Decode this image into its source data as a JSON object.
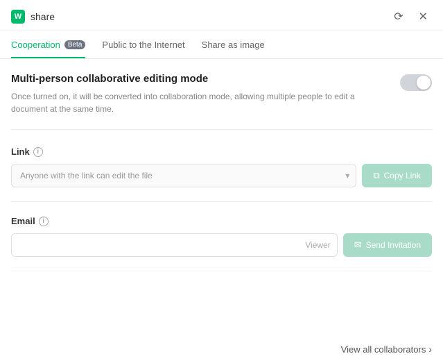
{
  "titleBar": {
    "appName": "share",
    "appIconText": "W",
    "refreshLabel": "⟳",
    "closeLabel": "✕"
  },
  "tabs": [
    {
      "id": "cooperation",
      "label": "Cooperation",
      "active": true,
      "badge": "Beta"
    },
    {
      "id": "public",
      "label": "Public to the Internet",
      "active": false
    },
    {
      "id": "share-image",
      "label": "Share as image",
      "active": false
    }
  ],
  "collab": {
    "title": "Multi-person collaborative editing mode",
    "description": "Once turned on, it will be converted into collaboration mode, allowing multiple people to edit a document at the same time.",
    "toggleEnabled": false
  },
  "linkSection": {
    "label": "Link",
    "selectPlaceholder": "Anyone with the link can edit the file",
    "copyButtonLabel": "Copy Link",
    "copyIconSymbol": "⧉"
  },
  "emailSection": {
    "label": "Email",
    "inputPlaceholder": "",
    "viewerLabel": "Viewer",
    "sendButtonLabel": "Send Invitation",
    "sendIconSymbol": "✉"
  },
  "footer": {
    "viewAllLabel": "View all collaborators",
    "chevron": "›"
  }
}
